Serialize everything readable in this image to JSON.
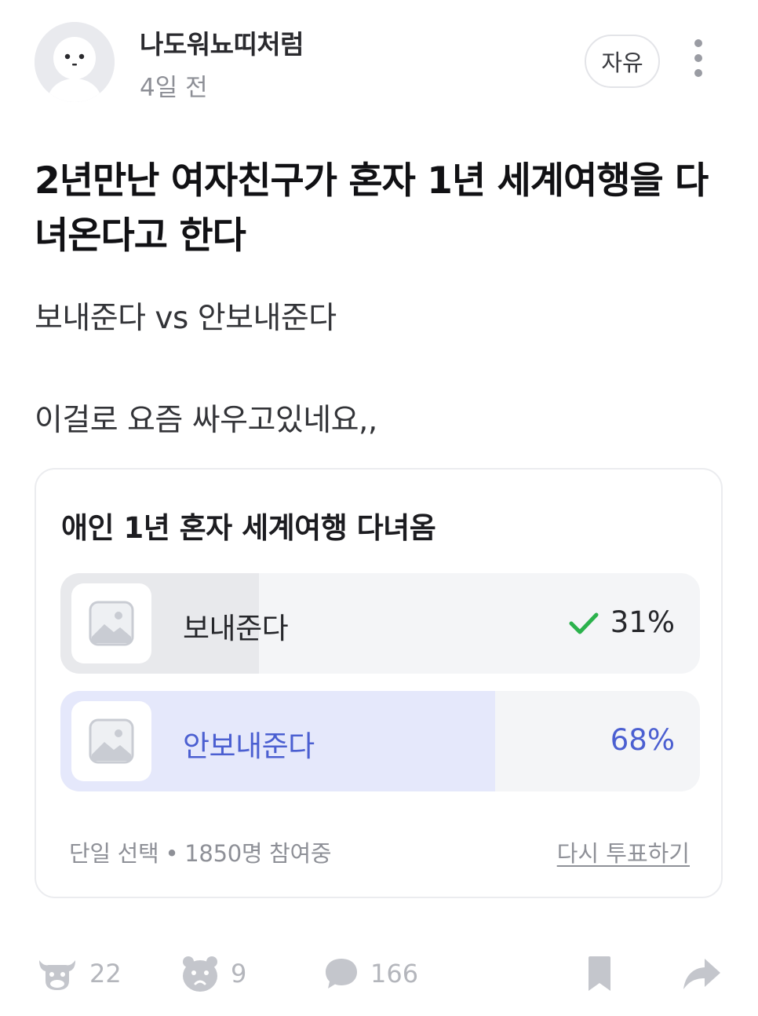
{
  "post": {
    "author": "나도워뇨띠처럼",
    "time": "4일 전",
    "category": "자유",
    "title": "2년만난 여자친구가 혼자 1년 세계여행을 다녀온다고 한다",
    "body": [
      "보내준다 vs 안보내준다",
      "이걸로 요즘 싸우고있네요,,"
    ]
  },
  "poll": {
    "title": "애인 1년 혼자 세계여행 다녀옴",
    "options": [
      {
        "label": "보내준다",
        "percent": "31%",
        "fraction": 0.31,
        "voted": true
      },
      {
        "label": "안보내준다",
        "percent": "68%",
        "fraction": 0.68,
        "voted": false
      }
    ],
    "meta_type": "단일 선택",
    "meta_sep": "•",
    "meta_count": "1850명 참여중",
    "revote": "다시 투표하기"
  },
  "actions": {
    "like_count": "22",
    "sad_count": "9",
    "comment_count": "166"
  },
  "colors": {
    "accent": "#4b5fd1",
    "check": "#2bb24c"
  }
}
